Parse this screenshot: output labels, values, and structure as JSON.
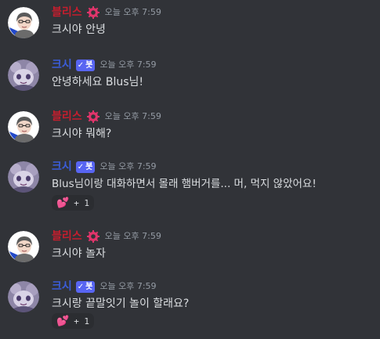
{
  "messages": [
    {
      "author": "블리스",
      "author_kind": "user",
      "timestamp": "오늘 오후 7:59",
      "text": "크시야 안녕",
      "reaction": null
    },
    {
      "author": "크시",
      "author_kind": "bot",
      "bot_tag": "봇",
      "timestamp": "오늘 오후 7:59",
      "text": "안녕하세요 Blus님!",
      "reaction": null
    },
    {
      "author": "블리스",
      "author_kind": "user",
      "timestamp": "오늘 오후 7:59",
      "text": "크시야 뭐해?",
      "reaction": null
    },
    {
      "author": "크시",
      "author_kind": "bot",
      "bot_tag": "봇",
      "timestamp": "오늘 오후 7:59",
      "text": "Blus님이랑 대화하면서 몰래 햄버거를... 머, 먹지 않았어요!",
      "reaction": {
        "emoji": "heart-icon",
        "count": "+ 1"
      }
    },
    {
      "author": "블리스",
      "author_kind": "user",
      "timestamp": "오늘 오후 7:59",
      "text": "크시야 놀자",
      "reaction": null
    },
    {
      "author": "크시",
      "author_kind": "bot",
      "bot_tag": "봇",
      "timestamp": "오늘 오후 7:59",
      "text": "크시랑 끝말잇기 놀이 할래요?",
      "reaction": {
        "emoji": "heart-icon",
        "count": "+ 1"
      }
    }
  ],
  "colors": {
    "background": "#313338",
    "blus_name": "#c41e2e",
    "ksi_name": "#3b5dd9",
    "bot_tag_bg": "#5865f2",
    "timestamp": "#949ba4",
    "text": "#dbdee1",
    "reaction_bg": "#2b2d31"
  }
}
